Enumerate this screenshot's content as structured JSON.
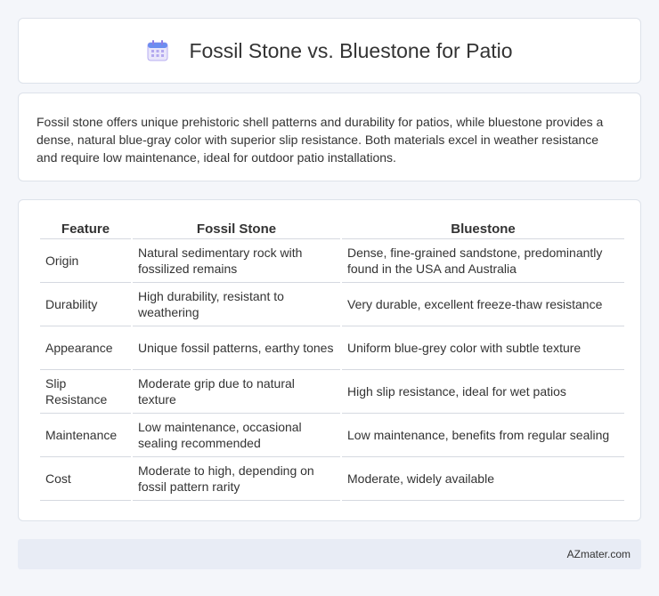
{
  "header": {
    "title": "Fossil Stone vs. Bluestone for Patio",
    "icon": "calendar-icon"
  },
  "intro": {
    "text": "Fossil stone offers unique prehistoric shell patterns and durability for patios, while bluestone provides a dense, natural blue-gray color with superior slip resistance. Both materials excel in weather resistance and require low maintenance, ideal for outdoor patio installations."
  },
  "table": {
    "headers": [
      "Feature",
      "Fossil Stone",
      "Bluestone"
    ],
    "rows": [
      [
        "Origin",
        "Natural sedimentary rock with fossilized remains",
        "Dense, fine-grained sandstone, predominantly found in the USA and Australia"
      ],
      [
        "Durability",
        "High durability, resistant to weathering",
        "Very durable, excellent freeze-thaw resistance"
      ],
      [
        "Appearance",
        "Unique fossil patterns, earthy tones",
        "Uniform blue-grey color with subtle texture"
      ],
      [
        "Slip Resistance",
        "Moderate grip due to natural texture",
        "High slip resistance, ideal for wet patios"
      ],
      [
        "Maintenance",
        "Low maintenance, occasional sealing recommended",
        "Low maintenance, benefits from regular sealing"
      ],
      [
        "Cost",
        "Moderate to high, depending on fossil pattern rarity",
        "Moderate, widely available"
      ]
    ]
  },
  "footer": {
    "brand": "AZmater.com"
  }
}
